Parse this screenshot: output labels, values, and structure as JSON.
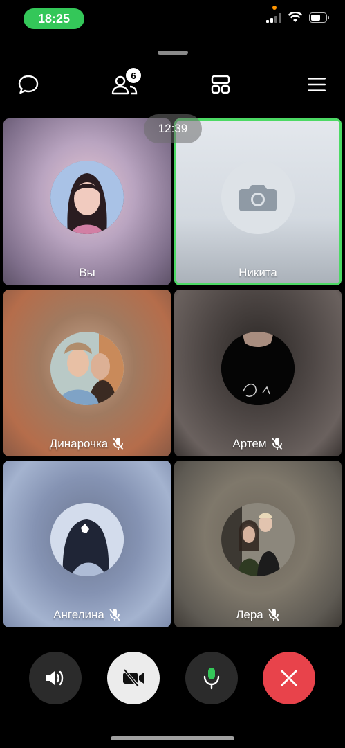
{
  "status": {
    "time": "18:25"
  },
  "toolbar": {
    "participants_count": "6",
    "icons": [
      "chat-icon",
      "participants-icon",
      "grid-layout-icon",
      "menu-icon"
    ]
  },
  "call": {
    "timer": "12:39"
  },
  "participants": [
    {
      "name": "Вы",
      "muted": false
    },
    {
      "name": "Никита",
      "muted": false,
      "speaking": true
    },
    {
      "name": "Динарочка",
      "muted": true
    },
    {
      "name": "Артем",
      "muted": true
    },
    {
      "name": "Ангелина",
      "muted": true
    },
    {
      "name": "Лера",
      "muted": true
    }
  ],
  "controls": [
    "speaker",
    "video-off",
    "microphone",
    "end-call"
  ],
  "colors": {
    "accent_green": "#34c759",
    "end_call_red": "#e8434b",
    "speaking_border": "#4cd964"
  }
}
